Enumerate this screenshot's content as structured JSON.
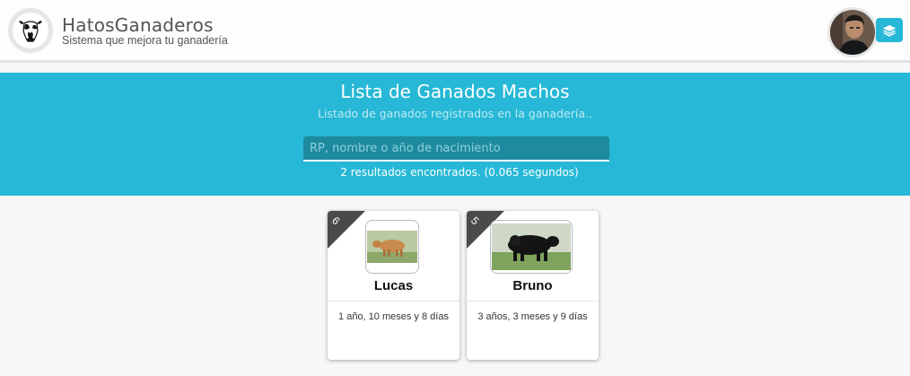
{
  "header": {
    "brand_title": "HatosGanaderos",
    "brand_subtitle": "Sistema que mejora tu ganadería",
    "logo_icon": "cow-head-icon",
    "user_icon": "user-avatar",
    "layers_icon": "layers-icon"
  },
  "banner": {
    "title": "Lista de Ganados Machos",
    "subtitle": "Listado de ganados registrados en la ganadería..",
    "search_placeholder": "RP, nombre o año de nacimiento",
    "search_value": "",
    "results_text": "2 resultados encontrados. (0.065 segundos)"
  },
  "cards": [
    {
      "badge": "6",
      "name": "Lucas",
      "age": "1 año, 10 meses y 8 días",
      "photo_icon": "brown-bull-photo"
    },
    {
      "badge": "5",
      "name": "Bruno",
      "age": "3 años, 3 meses y 9 días",
      "photo_icon": "black-bull-photo"
    }
  ],
  "colors": {
    "accent": "#26b8d6",
    "search_bg": "#1d8a9e",
    "ribbon": "#4a4a4a"
  }
}
